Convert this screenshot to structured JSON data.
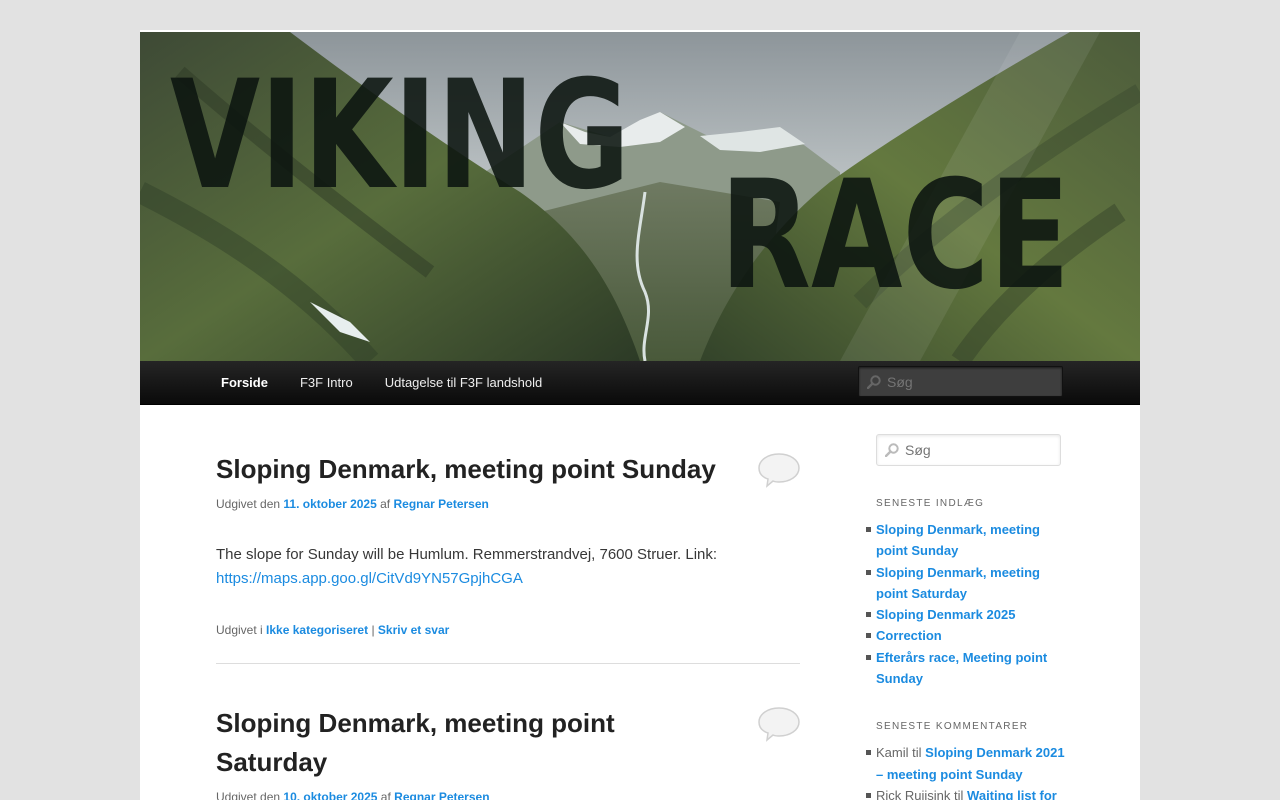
{
  "banner": {
    "alt": "Viking Race",
    "logo_text_1": "VIKING",
    "logo_text_2": "RACE"
  },
  "nav": {
    "items": [
      {
        "label": "Forside",
        "current": true
      },
      {
        "label": "F3F Intro",
        "current": false
      },
      {
        "label": "Udtagelse til F3F landshold",
        "current": false
      }
    ],
    "search_placeholder": "Søg"
  },
  "posts": [
    {
      "title": "Sloping Denmark, meeting point Sunday",
      "meta_prefix": "Udgivet den",
      "date": "11. oktober 2025",
      "meta_by": "af",
      "author": "Regnar Petersen",
      "body_text": "The slope for Sunday will be Humlum. Remmerstrandvej, 7600 Struer. Link:",
      "body_link": "https://maps.app.goo.gl/CitVd9YN57GpjhCGA",
      "footer_prefix": "Udgivet i",
      "category": "Ikke kategoriseret",
      "sep": "|",
      "reply": "Skriv et svar"
    },
    {
      "title": "Sloping Denmark, meeting point Saturday",
      "meta_prefix": "Udgivet den",
      "date": "10. oktober 2025",
      "meta_by": "af",
      "author": "Regnar Petersen"
    }
  ],
  "sidebar": {
    "search_placeholder": "Søg",
    "recent_posts_title": "SENESTE INDLÆG",
    "recent_posts": [
      "Sloping Denmark, meeting point Sunday",
      "Sloping Denmark, meeting point Saturday",
      "Sloping Denmark 2025",
      "Correction",
      "Efterårs race, Meeting point Sunday"
    ],
    "recent_comments_title": "SENESTE KOMMENTARER",
    "recent_comments": [
      {
        "author": "Kamil",
        "connector": "til",
        "post": "Sloping Denmark 2021 – meeting point Sunday"
      },
      {
        "author": "Rick Ruijsink",
        "connector": "til",
        "post": "Waiting list for"
      }
    ]
  },
  "colors": {
    "link": "#1b8be0",
    "nav_bg": "#1c1c1c",
    "page_bg": "#e2e2e2"
  }
}
